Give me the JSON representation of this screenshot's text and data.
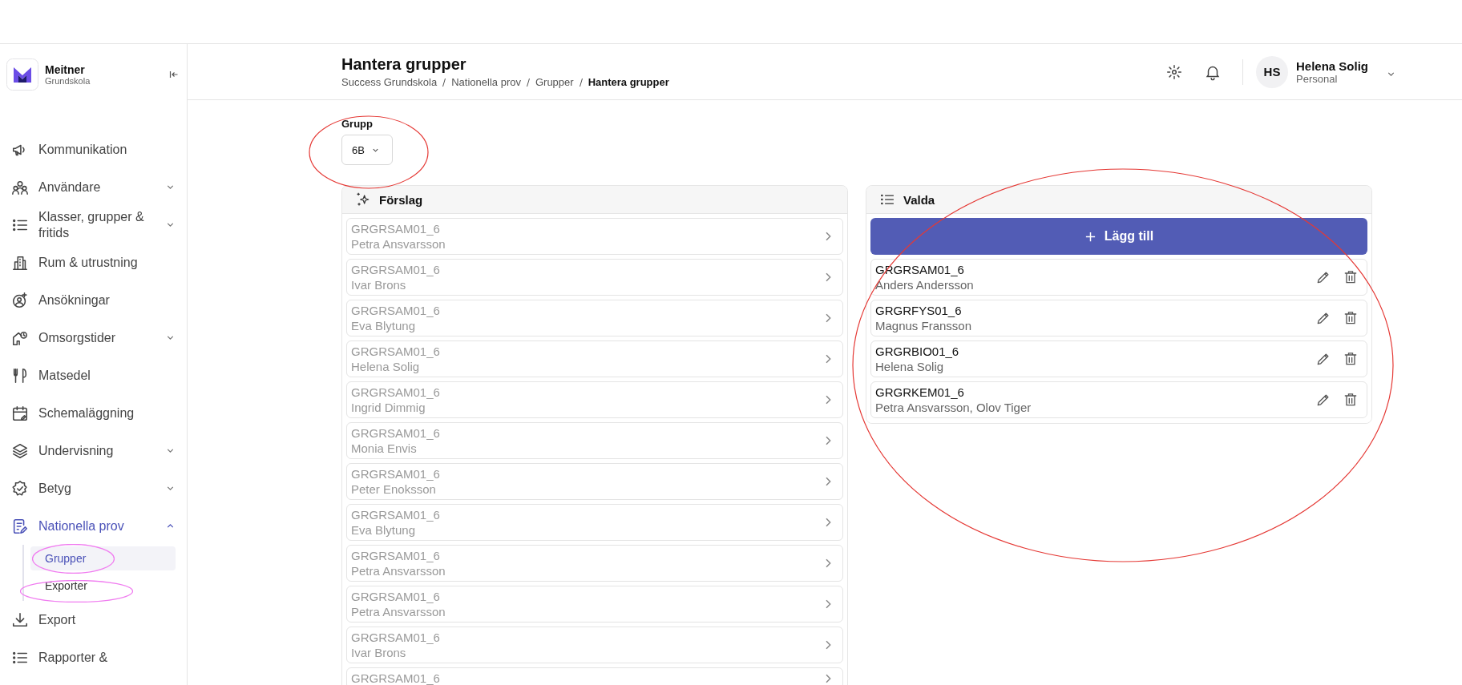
{
  "brand": {
    "name": "Meitner",
    "subtitle": "Grundskola"
  },
  "nav": [
    {
      "label": "Kommunikation",
      "selected": false
    },
    {
      "label": "Användare",
      "selected": false,
      "expanded": false
    },
    {
      "label": "Klasser, grupper & fritids",
      "selected": false,
      "expanded": false
    },
    {
      "label": "Rum & utrustning",
      "selected": false
    },
    {
      "label": "Ansökningar",
      "selected": false
    },
    {
      "label": "Omsorgstider",
      "selected": false,
      "expanded": false
    },
    {
      "label": "Matsedel",
      "selected": false
    },
    {
      "label": "Schemaläggning",
      "selected": false
    },
    {
      "label": "Undervisning",
      "selected": false,
      "expanded": false
    },
    {
      "label": "Betyg",
      "selected": false,
      "expanded": false
    },
    {
      "label": "Nationella prov",
      "selected": true,
      "expanded": true,
      "children": [
        {
          "label": "Grupper",
          "selected": true
        },
        {
          "label": "Exporter",
          "selected": false
        }
      ]
    },
    {
      "label": "Export",
      "selected": false
    },
    {
      "label": "Rapporter &",
      "selected": false
    }
  ],
  "header": {
    "title": "Hantera grupper",
    "breadcrumb": [
      "Success Grundskola",
      "Nationella prov",
      "Grupper",
      "Hantera grupper"
    ],
    "user": {
      "initials": "HS",
      "name": "Helena Solig",
      "role": "Personal"
    }
  },
  "group_select": {
    "label": "Grupp",
    "value": "6B"
  },
  "suggestions": {
    "title": "Förslag",
    "rows": [
      {
        "code": "GRGRSAM01_6",
        "teacher": "Petra Ansvarsson"
      },
      {
        "code": "GRGRSAM01_6",
        "teacher": "Ivar Brons"
      },
      {
        "code": "GRGRSAM01_6",
        "teacher": "Eva Blytung"
      },
      {
        "code": "GRGRSAM01_6",
        "teacher": "Helena Solig"
      },
      {
        "code": "GRGRSAM01_6",
        "teacher": "Ingrid Dimmig"
      },
      {
        "code": "GRGRSAM01_6",
        "teacher": "Monia Envis"
      },
      {
        "code": "GRGRSAM01_6",
        "teacher": "Peter Enoksson"
      },
      {
        "code": "GRGRSAM01_6",
        "teacher": "Eva Blytung"
      },
      {
        "code": "GRGRSAM01_6",
        "teacher": "Petra Ansvarsson"
      },
      {
        "code": "GRGRSAM01_6",
        "teacher": "Petra Ansvarsson"
      },
      {
        "code": "GRGRSAM01_6",
        "teacher": "Ivar Brons"
      },
      {
        "code": "GRGRSAM01_6"
      }
    ]
  },
  "selected": {
    "title": "Valda",
    "add_button": "Lägg till",
    "rows": [
      {
        "code": "GRGRSAM01_6",
        "teacher": "Anders Andersson"
      },
      {
        "code": "GRGRFYS01_6",
        "teacher": "Magnus Fransson"
      },
      {
        "code": "GRGRBIO01_6",
        "teacher": "Helena Solig"
      },
      {
        "code": "GRGRKEM01_6",
        "teacher": "Petra Ansvarsson, Olov Tiger"
      }
    ]
  }
}
